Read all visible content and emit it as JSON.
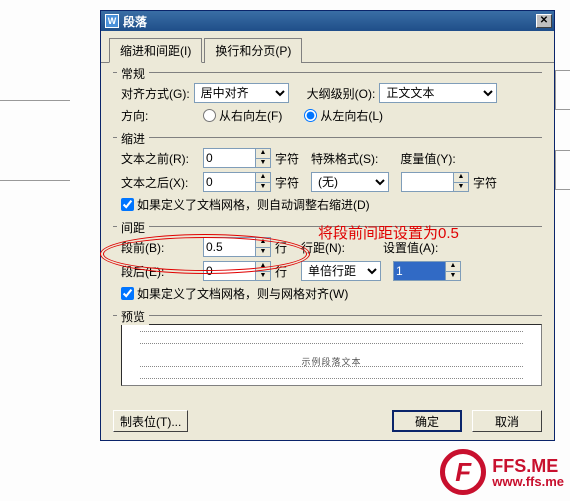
{
  "dialog": {
    "title": "段落",
    "tabs": {
      "indent": "缩进和间距(I)",
      "pagebreak": "换行和分页(P)"
    }
  },
  "general": {
    "legend": "常规",
    "alignLabel": "对齐方式(G):",
    "alignValue": "居中对齐",
    "outlineLabel": "大纲级别(O):",
    "outlineValue": "正文文本",
    "directionLabel": "方向:",
    "rtl": "从右向左(F)",
    "ltr": "从左向右(L)"
  },
  "indent": {
    "legend": "缩进",
    "beforeLabel": "文本之前(R):",
    "beforeValue": "0",
    "beforeUnit": "字符",
    "afterLabel": "文本之后(X):",
    "afterValue": "0",
    "afterUnit": "字符",
    "specialLabel": "特殊格式(S):",
    "specialValue": "(无)",
    "measureLabel": "度量值(Y):",
    "measureValue": "",
    "measureUnit": "字符",
    "autoAdjust": "如果定义了文档网格，则自动调整右缩进(D)"
  },
  "spacing": {
    "legend": "间距",
    "beforeLabel": "段前(B):",
    "beforeValue": "0.5",
    "beforeUnit": "行",
    "afterLabel": "段后(E):",
    "afterValue": "0",
    "afterUnit": "行",
    "lineSpacingLabel": "行距(N):",
    "lineSpacingValue": "单倍行距",
    "setValueLabel": "设置值(A):",
    "setValueValue": "1",
    "gridAlign": "如果定义了文档网格，则与网格对齐(W)"
  },
  "preview": {
    "legend": "预览",
    "sample": "示例段落文本"
  },
  "footer": {
    "tabs": "制表位(T)...",
    "ok": "确定",
    "cancel": "取消"
  },
  "annotation": "将段前间距设置为0.5",
  "watermark": {
    "line1": "FFS.ME",
    "line2": "www.ffs.me"
  }
}
